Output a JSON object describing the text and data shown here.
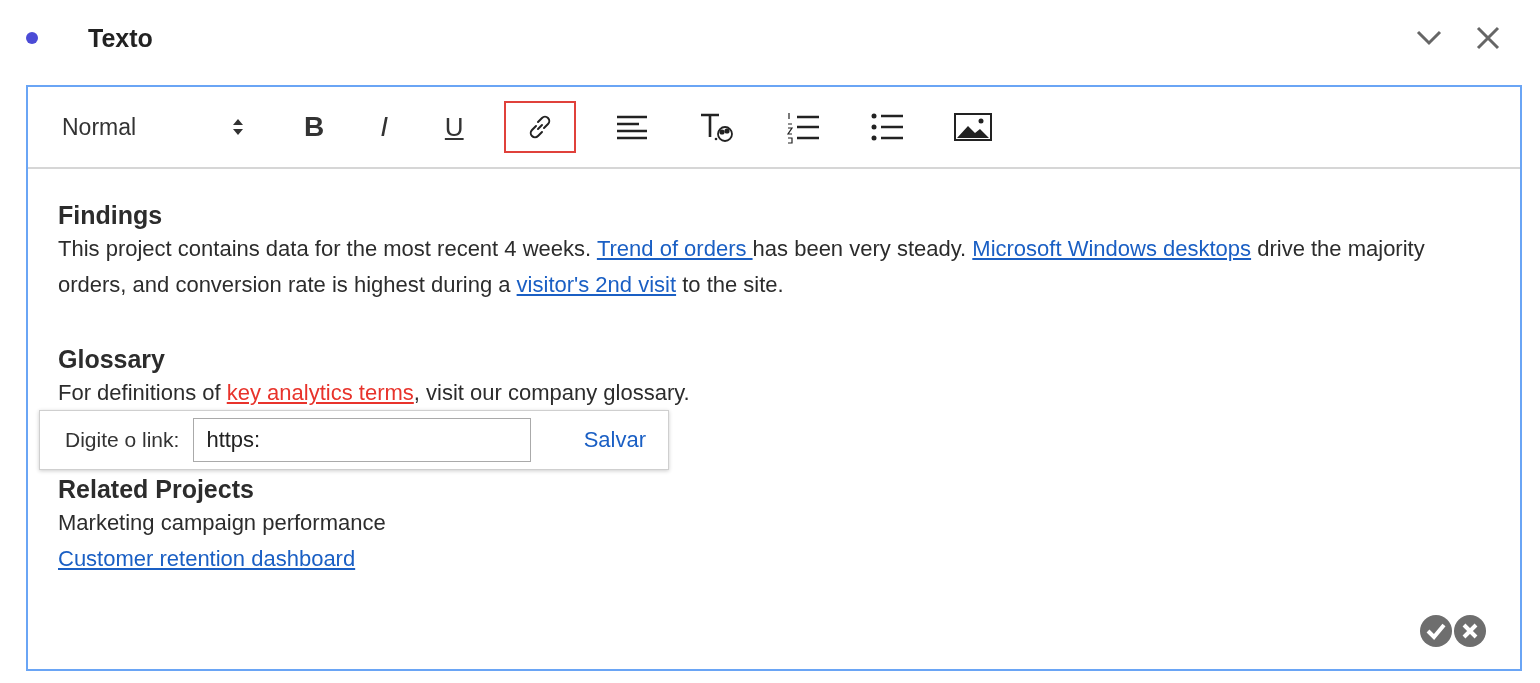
{
  "panel": {
    "title": "Texto"
  },
  "toolbar": {
    "style_select": "Normal",
    "tools": [
      {
        "kind": "bold",
        "label": "B",
        "selected": false
      },
      {
        "kind": "italic",
        "label": "I",
        "selected": false
      },
      {
        "kind": "underline",
        "label": "U",
        "selected": false
      },
      {
        "kind": "link",
        "selected": true
      },
      {
        "kind": "align",
        "selected": false
      },
      {
        "kind": "text-format",
        "selected": false
      },
      {
        "kind": "ordered-list",
        "selected": false
      },
      {
        "kind": "bullet-list",
        "selected": false
      },
      {
        "kind": "image",
        "selected": false
      }
    ]
  },
  "content": [
    {
      "kind": "heading",
      "text": "Findings"
    },
    {
      "kind": "paragraph",
      "segments": [
        {
          "kind": "text",
          "text": "This project contains data for the most recent 4 weeks. "
        },
        {
          "kind": "link",
          "text": "Trend of orders "
        },
        {
          "kind": "text",
          "text": "has been very steady. "
        },
        {
          "kind": "link",
          "text": "Microsoft Windows desktops"
        },
        {
          "kind": "text",
          "text": " drive the majority orders, and conversion rate is highest during a "
        },
        {
          "kind": "link",
          "text": "visitor's 2nd visit"
        },
        {
          "kind": "text",
          "text": " to the site."
        }
      ]
    },
    {
      "kind": "heading",
      "text": "Glossary"
    },
    {
      "kind": "paragraph",
      "segments": [
        {
          "kind": "text",
          "text": "For definitions of "
        },
        {
          "kind": "broken-link",
          "text": "key analytics terms"
        },
        {
          "kind": "text",
          "text": ", visit our company glossary."
        }
      ]
    },
    {
      "kind": "heading",
      "text": "Related Projects"
    },
    {
      "kind": "paragraph",
      "segments": [
        {
          "kind": "text",
          "text": "Marketing campaign performance"
        }
      ]
    },
    {
      "kind": "paragraph",
      "segments": [
        {
          "kind": "link",
          "text": "Customer retention dashboard"
        }
      ]
    }
  ],
  "link_popup": {
    "label": "Digite o link:",
    "value": "https:",
    "save": "Salvar"
  }
}
